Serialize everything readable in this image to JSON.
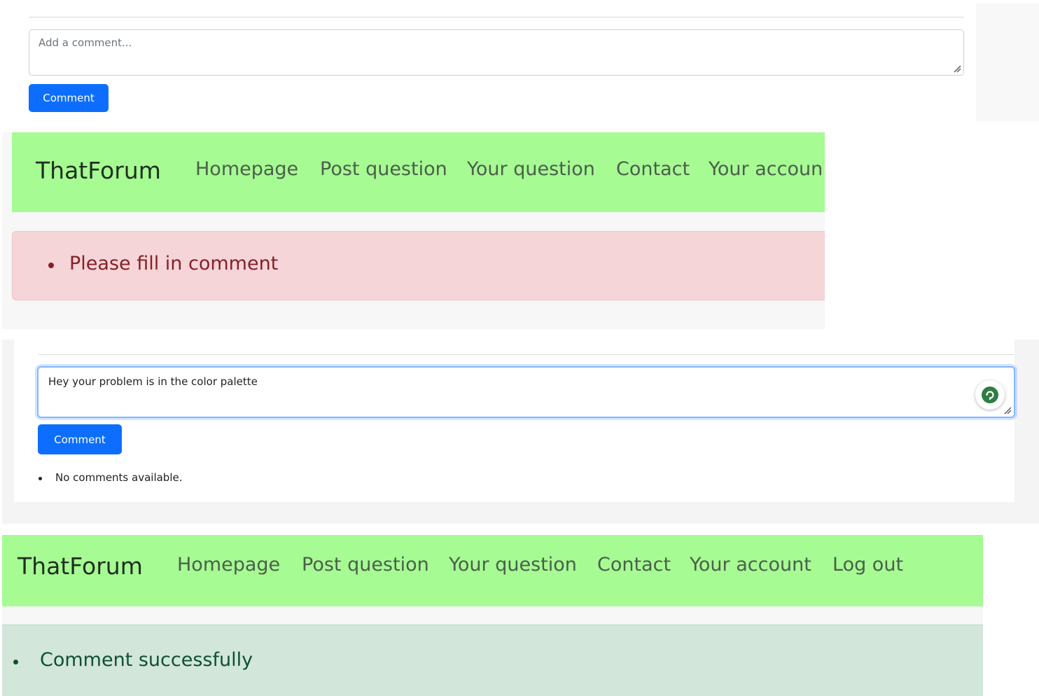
{
  "panel_empty_form": {
    "comment_placeholder": "Add a comment...",
    "comment_button": "Comment"
  },
  "panel_error": {
    "navbar": {
      "brand": "ThatForum",
      "links": [
        "Homepage",
        "Post question",
        "Your question",
        "Contact",
        "Your accoun"
      ]
    },
    "alert_message": "Please fill in comment"
  },
  "panel_filled_form": {
    "comment_value": "Hey your problem is in the color palette",
    "comment_button": "Comment",
    "comments_list": [
      "No comments available."
    ]
  },
  "panel_success": {
    "navbar": {
      "brand": "ThatForum",
      "links": [
        "Homepage",
        "Post question",
        "Your question",
        "Contact",
        "Your account",
        "Log out"
      ]
    },
    "alert_message": "Comment successfully"
  },
  "colors": {
    "navbar_bg": "#a6fb93",
    "primary_button": "#0d6efd",
    "danger_alert_bg": "#f5d5d7",
    "danger_text": "#842029",
    "success_alert_bg": "#d2e6da",
    "success_text": "#0f5132"
  },
  "icons": {
    "textarea_resize": "resize-handle-icon",
    "grammar_assistant": "grammar-check-icon"
  }
}
